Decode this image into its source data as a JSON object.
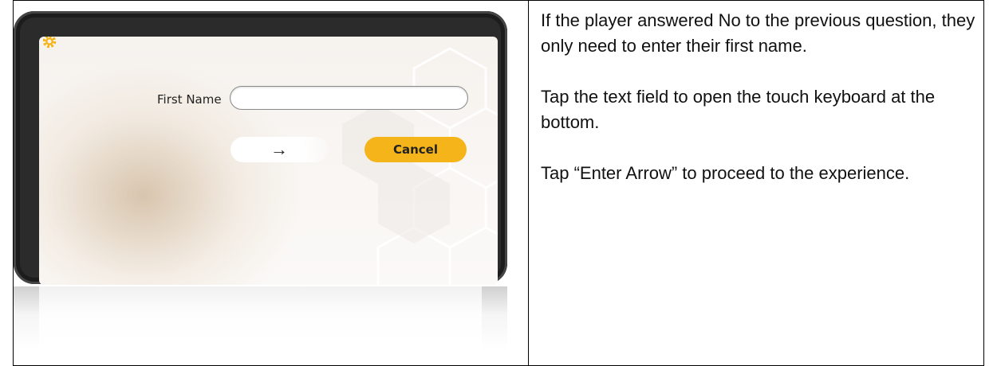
{
  "app": {
    "form": {
      "first_name_label": "First Name",
      "first_name_value": "",
      "enter_symbol": "→",
      "cancel_label": "Cancel"
    },
    "colors": {
      "accent": "#f5b51a",
      "bezel": "#2b2b2b"
    },
    "icons": {
      "settings": "gear-icon",
      "enter": "arrow-right-icon"
    }
  },
  "instructions": [
    "If the player answered No to the previous question, they only need to enter their first name.",
    "Tap the text field to open the touch keyboard at the bottom.",
    "Tap “Enter Arrow” to proceed to the experience."
  ]
}
